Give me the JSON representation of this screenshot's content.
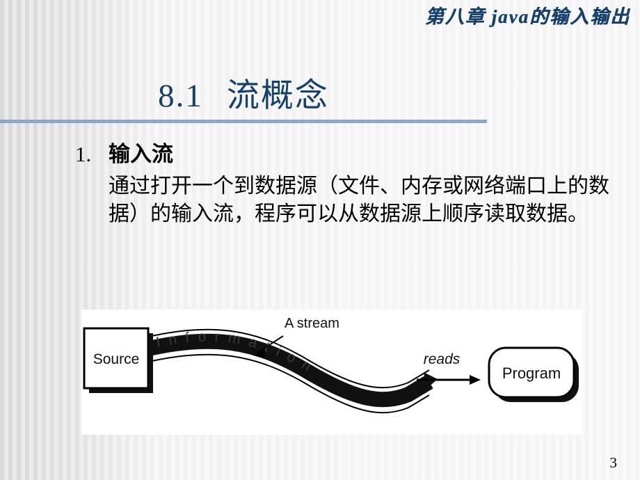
{
  "header": {
    "chapter_title": "第八章 java的输入输出"
  },
  "title": {
    "number": "8.1",
    "text": "流概念"
  },
  "body": {
    "item_number": "1.",
    "item_heading": "输入流",
    "paragraph": "通过打开一个到数据源（文件、内存或网络端口上的数据）的输入流，程序可以从数据源上顺序读取数据。"
  },
  "figure": {
    "source_label": "Source",
    "program_label": "Program",
    "stream_label": "A stream",
    "reads_label": "reads",
    "band_text": "Information"
  },
  "footer": {
    "page_number": "3"
  },
  "colors": {
    "title": "#14406b",
    "rule": "#8ea8c3",
    "body_text": "#000000",
    "figure_bg": "#ffffff",
    "stripe_dark": "#d9d9d9",
    "stripe_light": "#e9e9e9"
  }
}
